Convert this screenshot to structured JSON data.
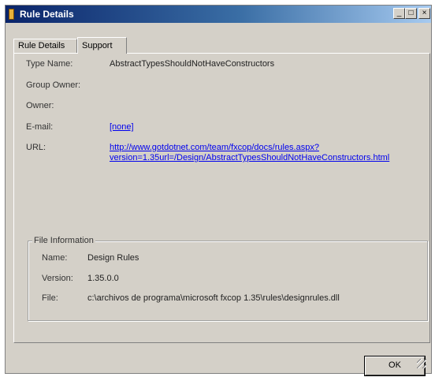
{
  "window": {
    "title": "Rule Details",
    "min_label": "_",
    "max_label": "□",
    "close_label": "×"
  },
  "tabs": [
    {
      "label": "Rule Details",
      "active": false
    },
    {
      "label": "Support",
      "active": true
    }
  ],
  "details": {
    "type_name_label": "Type Name:",
    "type_name_value": "AbstractTypesShouldNotHaveConstructors",
    "group_owner_label": "Group Owner:",
    "owner_label": "Owner:",
    "email_label": "E-mail:",
    "email_value": "[none]",
    "url_label": "URL:",
    "url_line1": "http://www.gotdotnet.com/team/fxcop/docs/rules.aspx?",
    "url_line2": "version=1.35url=/Design/AbstractTypesShouldNotHaveConstructors.html"
  },
  "file_info": {
    "legend": "File Information",
    "name_label": "Name:",
    "name_value": "Design Rules",
    "version_label": "Version:",
    "version_value": "1.35.0.0",
    "file_label": "File:",
    "file_value": "c:\\archivos de programa\\microsoft fxcop 1.35\\rules\\designrules.dll"
  },
  "buttons": {
    "ok_label": "OK"
  }
}
